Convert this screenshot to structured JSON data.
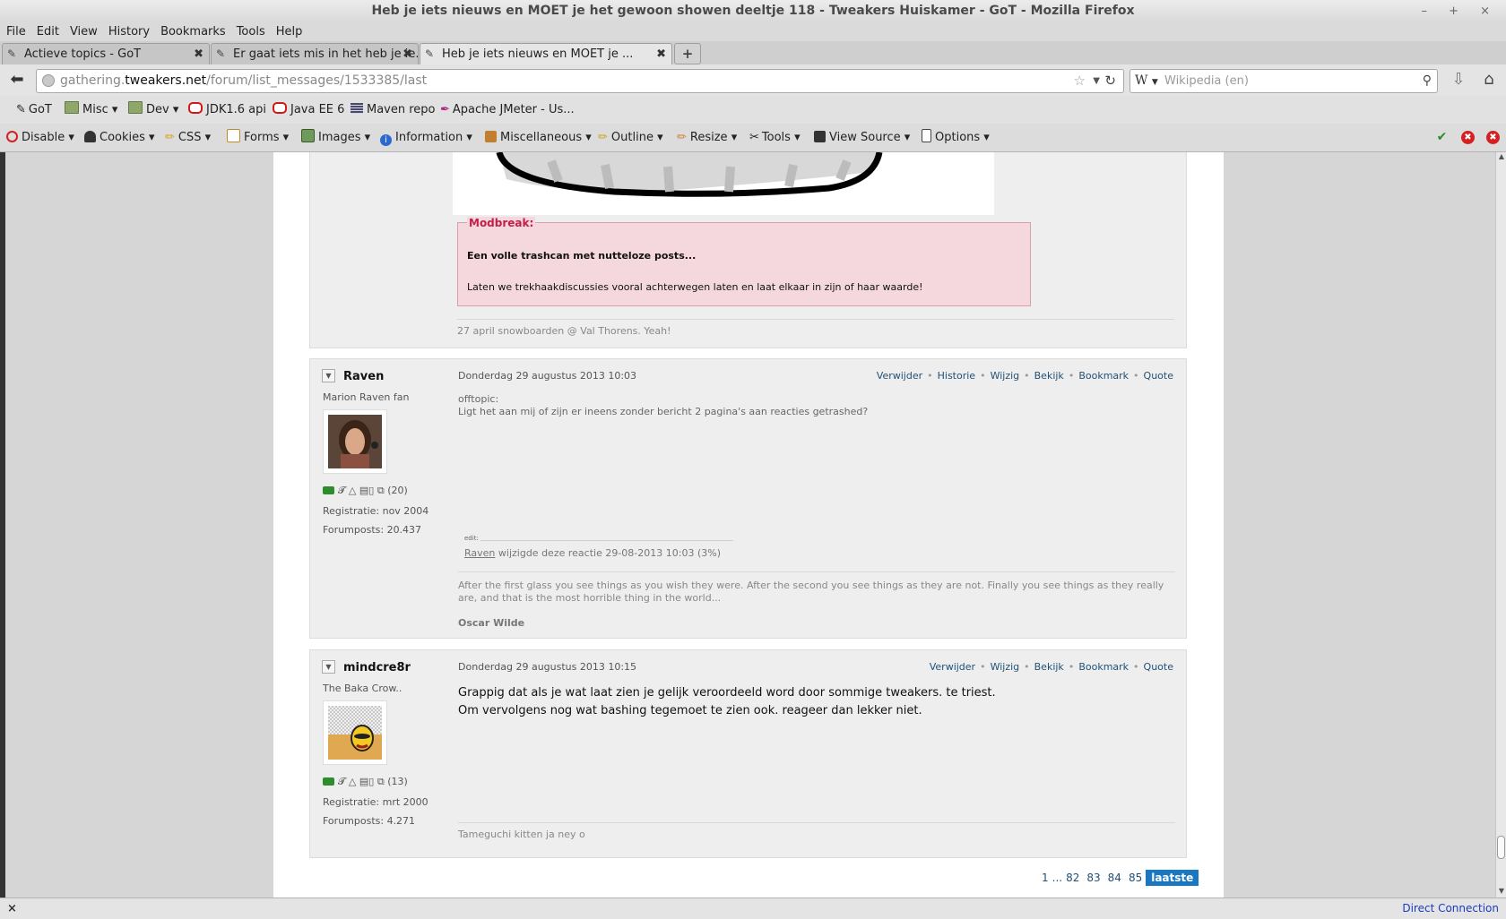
{
  "window": {
    "title": "Heb je iets nieuws en MOET je het gewoon showen deeltje 118 - Tweakers Huiskamer - GoT - Mozilla Firefox",
    "controls": "– + ×"
  },
  "menu": [
    "File",
    "Edit",
    "View",
    "History",
    "Bookmarks",
    "Tools",
    "Help"
  ],
  "tabs": [
    {
      "label": "Actieve topics - GoT",
      "active": false
    },
    {
      "label": "Er gaat iets mis in het heb je ie...",
      "active": false
    },
    {
      "label": "Heb je iets nieuws en MOET je ...",
      "active": true
    }
  ],
  "newtab": "+",
  "nav": {
    "url_prefix": "gathering.",
    "url_domain": "tweakers.net",
    "url_path": "/forum/list_messages/1533385/last",
    "search_engine_glyph": "W",
    "search_placeholder": "Wikipedia (en)"
  },
  "bookmarks": [
    {
      "label": "GoT",
      "icon": "got-icon"
    },
    {
      "label": "Misc ▾",
      "icon": "folder-icon"
    },
    {
      "label": "Dev ▾",
      "icon": "folder-icon"
    },
    {
      "label": "JDK1.6 api",
      "icon": "oracle-icon"
    },
    {
      "label": "Java EE 6",
      "icon": "oracle-icon"
    },
    {
      "label": "Maven repo",
      "icon": "maven-icon"
    },
    {
      "label": "Apache JMeter - Us...",
      "icon": "feather-icon"
    }
  ],
  "webdev": [
    {
      "label": "Disable ▾",
      "color": "#d42020"
    },
    {
      "label": "Cookies ▾",
      "color": "#333333"
    },
    {
      "label": "CSS ▾",
      "color": "#d6a020"
    },
    {
      "label": "Forms ▾",
      "color": "#c48a2a"
    },
    {
      "label": "Images ▾",
      "color": "#4f7a3a"
    },
    {
      "label": "Information ▾",
      "color": "#2a6ad0"
    },
    {
      "label": "Miscellaneous ▾",
      "color": "#c08030"
    },
    {
      "label": "Outline ▾",
      "color": "#d0a020"
    },
    {
      "label": "Resize ▾",
      "color": "#d08030"
    },
    {
      "label": "Tools ▾",
      "color": "#555555"
    },
    {
      "label": "View Source ▾",
      "color": "#333333"
    },
    {
      "label": "Options ▾",
      "color": "#444444"
    }
  ],
  "webdev_right": {
    "ok": "✔",
    "err1": "✖",
    "err2": "✖",
    "ok_color": "#2e8b2e",
    "err_color": "#d42020"
  },
  "modbreak": {
    "title": "Modbreak:",
    "line1": "Een volle trashcan met nutteloze posts...",
    "line2": "Laten we trekhaakdiscussies vooral achterwegen laten en laat elkaar in zijn of haar waarde!"
  },
  "prev_signature": "27 april snowboarden @ Val Thorens. Yeah!",
  "posts": [
    {
      "user": "Raven",
      "user_title": "Marion Raven fan",
      "icon_count": "(20)",
      "registration": "Registratie: nov 2004",
      "forumposts": "Forumposts: 20.437",
      "date": "Donderdag 29 augustus 2013 10:03",
      "actions": [
        "Verwijder",
        "Historie",
        "Wijzig",
        "Bekijk",
        "Bookmark",
        "Quote"
      ],
      "offtopic_label": "offtopic:",
      "offtopic_text": "Ligt het aan mij of zijn er ineens zonder bericht 2 pagina's aan reacties getrashed?",
      "edit_label": "edit:",
      "edit_user": "Raven",
      "edit_text": " wijzigde deze reactie 29-08-2013 10:03 (3%)",
      "signature": "After the first glass you see things as you wish they were. After the second you see things as they are not. Finally you see things as they really are, and that is the most horrible thing in the world...",
      "signature_author": "Oscar Wilde"
    },
    {
      "user": "mindcre8r",
      "user_title": "The Baka Crow..",
      "icon_count": "(13)",
      "registration": "Registratie: mrt 2000",
      "forumposts": "Forumposts: 4.271",
      "date": "Donderdag 29 augustus 2013 10:15",
      "actions": [
        "Verwijder",
        "Wijzig",
        "Bekijk",
        "Bookmark",
        "Quote"
      ],
      "line1": "Grappig dat als je wat laat zien je gelijk veroordeeld word door sommige tweakers. te triest.",
      "line2": "Om vervolgens nog wat bashing tegemoet te zien ook. reageer dan lekker niet.",
      "signature": "Tameguchi kitten ja ney o"
    }
  ],
  "pager": [
    "1",
    "...",
    "82",
    "83",
    "84",
    "85"
  ],
  "pager_current": "laatste",
  "status": {
    "close": "×",
    "text": "Direct Connection"
  }
}
